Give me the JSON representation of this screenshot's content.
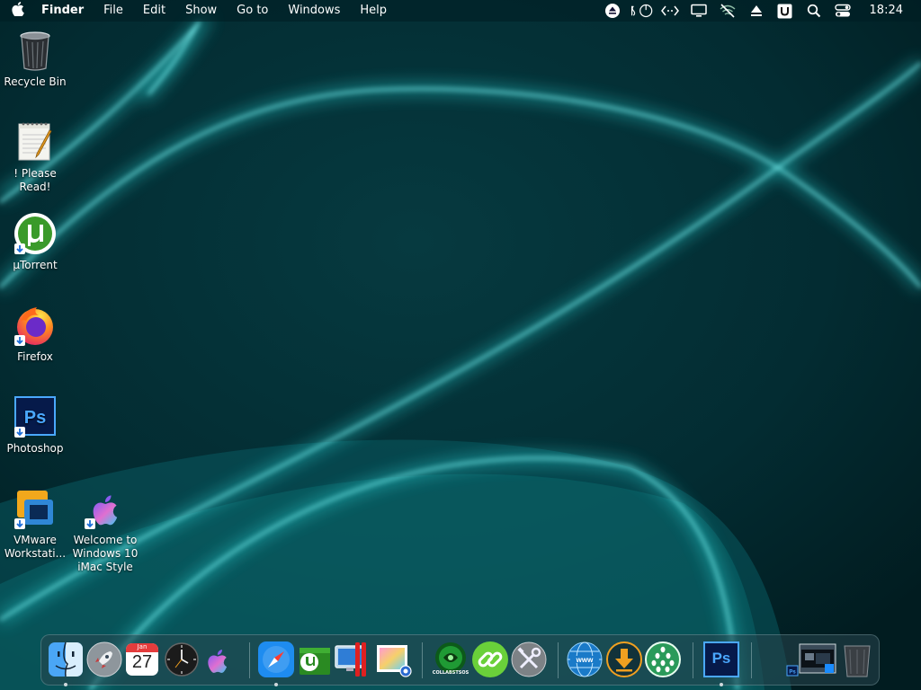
{
  "menubar": {
    "app_name": "Finder",
    "menus": [
      "File",
      "Edit",
      "Show",
      "Go to",
      "Windows",
      "Help"
    ],
    "status_icons": [
      "eject-icon",
      "power-icon",
      "network-code-icon",
      "display-icon",
      "wifi-off-icon",
      "upload-icon",
      "u-badge-icon",
      "search-icon",
      "control-center-icon"
    ],
    "clock": "18:24"
  },
  "desktop": {
    "icons": [
      {
        "label": "Recycle Bin"
      },
      {
        "label": "! Please Read!"
      },
      {
        "label": "µTorrent"
      },
      {
        "label": "Firefox"
      },
      {
        "label": "Photoshop"
      },
      {
        "label": "VMware Workstati..."
      },
      {
        "label": "Welcome to Windows 10 iMac Style"
      }
    ]
  },
  "dock": {
    "calendar": {
      "month": "Jan",
      "day": "27"
    },
    "collabstsos_label": "COLLABSTSOS",
    "photoshop_label": "Ps"
  },
  "colors": {
    "wallpaper_base": "#022a30",
    "glow": "#2ee6e6",
    "accent_blue": "#1a8cff"
  }
}
